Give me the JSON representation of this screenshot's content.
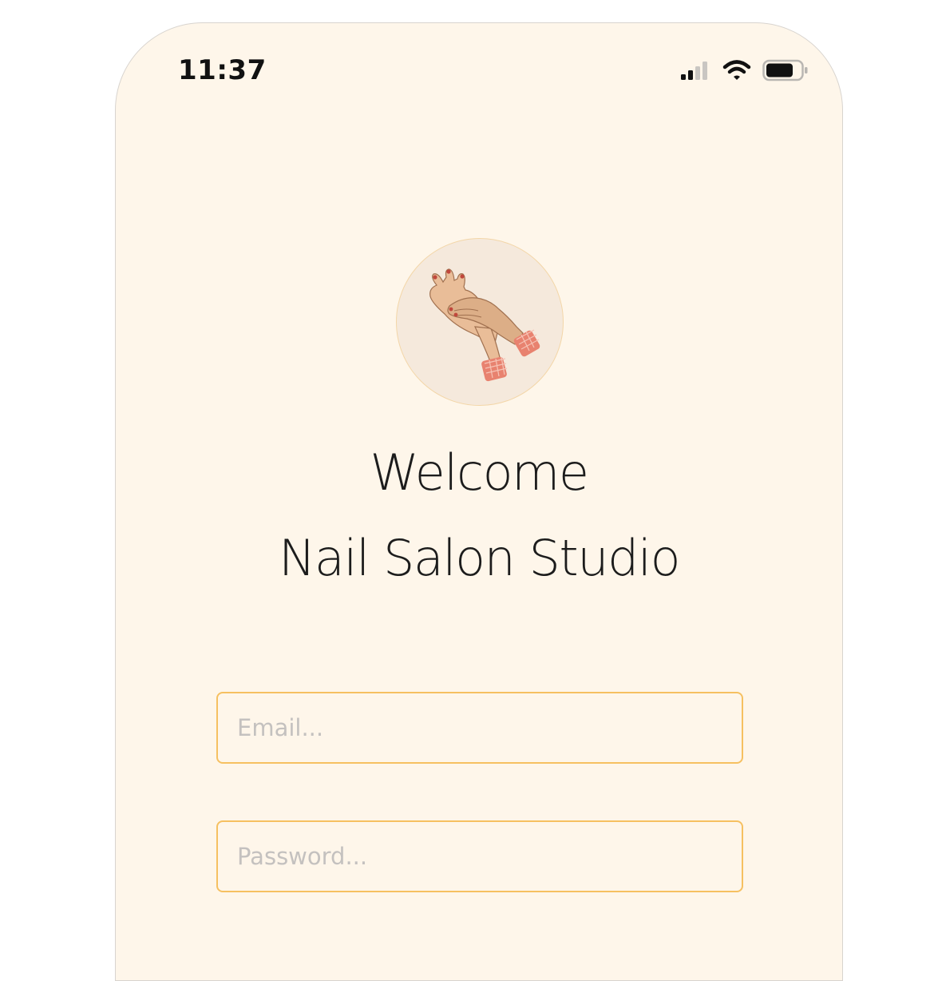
{
  "status_bar": {
    "time": "11:37",
    "icons": [
      "cellular-signal-icon",
      "wifi-icon",
      "battery-icon"
    ]
  },
  "logo": {
    "icon": "manicured-hands-illustration"
  },
  "welcome": {
    "line1": "Welcome",
    "line2": "Nail Salon Studio"
  },
  "form": {
    "email_placeholder": "Email...",
    "email_value": "",
    "password_placeholder": "Password...",
    "password_value": ""
  },
  "colors": {
    "background": "#fef6ea",
    "field_border": "#f6c061",
    "logo_bg": "#f5e9dc",
    "accent_pink": "#e8826f"
  }
}
